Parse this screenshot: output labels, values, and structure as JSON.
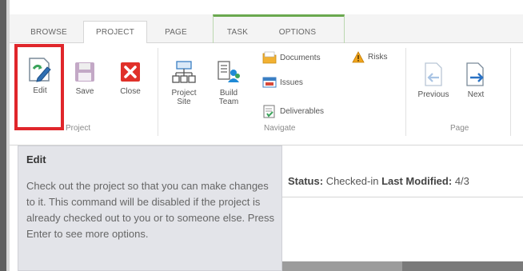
{
  "tabs": [
    {
      "label": "BROWSE"
    },
    {
      "label": "PROJECT"
    },
    {
      "label": "PAGE"
    },
    {
      "label": "TASK"
    },
    {
      "label": "OPTIONS"
    }
  ],
  "ribbon": {
    "project_group": {
      "label": "Project",
      "edit": "Edit",
      "save": "Save",
      "close": "Close"
    },
    "navigate_group": {
      "label": "Navigate",
      "project_site": "Project Site",
      "build_team": "Build Team",
      "documents": "Documents",
      "issues": "Issues",
      "deliverables": "Deliverables",
      "risks": "Risks"
    },
    "page_group": {
      "label": "Page",
      "previous": "Previous",
      "next": "Next"
    }
  },
  "tooltip": {
    "title": "Edit",
    "body": "Check out the project so that you can make changes to it. This command will be disabled if the project is already checked out to you or to someone else. Press Enter to see more options."
  },
  "status": {
    "status_label": "Status:",
    "status_value": "Checked-in",
    "modified_label": "Last Modified:",
    "modified_value": "4/3"
  },
  "colors": {
    "task_tab_accent": "#6aa84f",
    "highlight": "#e0262b",
    "tooltip_bg": "#e3e4e9"
  }
}
